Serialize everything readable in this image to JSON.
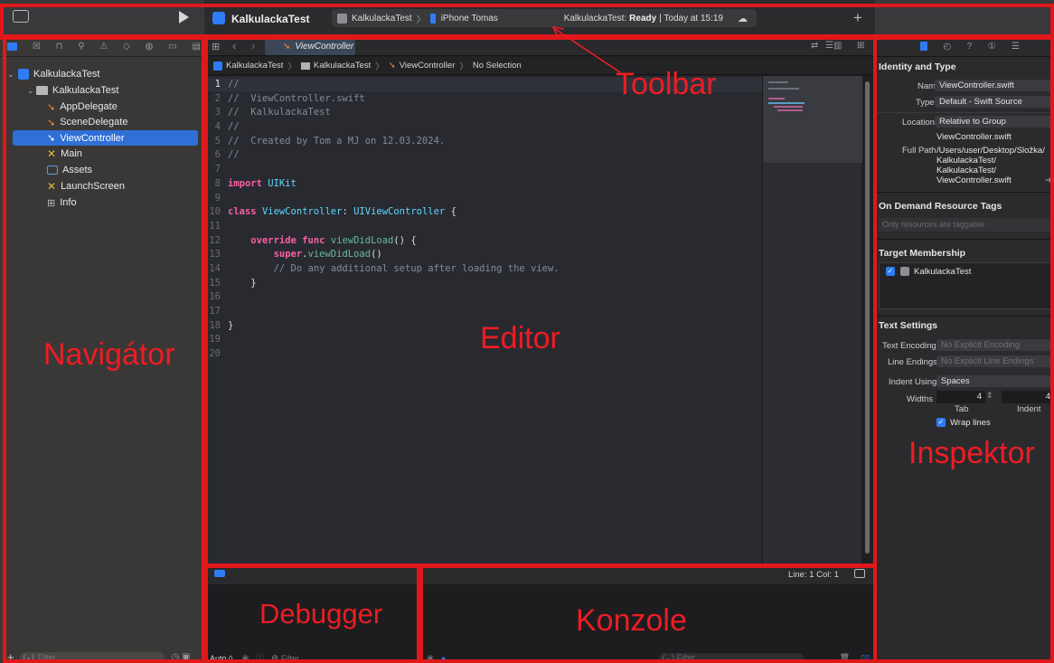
{
  "toolbar": {
    "project_name": "KalkulackaTest",
    "scheme": "KalkulackaTest",
    "destination": "iPhone Tomas",
    "status_app": "KalkulackaTest:",
    "status_state": "Ready",
    "status_time": "| Today at 15:19"
  },
  "navigator": {
    "root": "KalkulackaTest",
    "group": "KalkulackaTest",
    "files": [
      "AppDelegate",
      "SceneDelegate",
      "ViewController",
      "Main",
      "Assets",
      "LaunchScreen",
      "Info"
    ],
    "filter_placeholder": "Filter"
  },
  "editor": {
    "tab": "ViewController",
    "breadcrumb": [
      "KalkulackaTest",
      "KalkulackaTest",
      "ViewController",
      "No Selection"
    ],
    "lines": [
      "//",
      "//  ViewController.swift",
      "//  KalkulackaTest",
      "//",
      "//  Created by Tom a MJ on 12.03.2024.",
      "//",
      "",
      "import UIKit",
      "",
      "class ViewController: UIViewController {",
      "",
      "    override func viewDidLoad() {",
      "        super.viewDidLoad()",
      "        // Do any additional setup after loading the view.",
      "    }",
      "",
      "",
      "}",
      "",
      ""
    ]
  },
  "debug": {
    "cursor": "Line: 1  Col: 1",
    "auto": "Auto ◊",
    "filter": "Filter",
    "console_filter": "Filter"
  },
  "inspector": {
    "identity_title": "Identity and Type",
    "name_label": "Name",
    "name_value": "ViewController.swift",
    "type_label": "Type",
    "type_value": "Default - Swift Source",
    "location_label": "Location",
    "location_value": "Relative to Group",
    "location_file": "ViewController.swift",
    "fullpath_label": "Full Path",
    "fullpath_lines": [
      "/Users/user/Desktop/Složka/",
      "KalkulackaTest/",
      "KalkulackaTest/",
      "ViewController.swift"
    ],
    "ondemand_title": "On Demand Resource Tags",
    "ondemand_placeholder": "Only resources are taggable",
    "target_title": "Target Membership",
    "target_item": "KalkulackaTest",
    "text_title": "Text Settings",
    "encoding_label": "Text Encoding",
    "encoding_value": "No Explicit Encoding",
    "endings_label": "Line Endings",
    "endings_value": "No Explicit Line Endings",
    "indent_label": "Indent Using",
    "indent_value": "Spaces",
    "widths_label": "Widths",
    "tab_value": "4",
    "indent_width_value": "4",
    "tab_label": "Tab",
    "indent_sub_label": "Indent",
    "wrap_label": "Wrap lines"
  },
  "annotations": {
    "toolbar": "Toolbar",
    "navigator": "Navigátor",
    "editor": "Editor",
    "inspector": "Inspektor",
    "debugger": "Debugger",
    "console": "Konzole"
  },
  "colors": {
    "annotation_red": "#e0181b",
    "accent": "#2f7cf6",
    "swift": "#f0883e"
  }
}
